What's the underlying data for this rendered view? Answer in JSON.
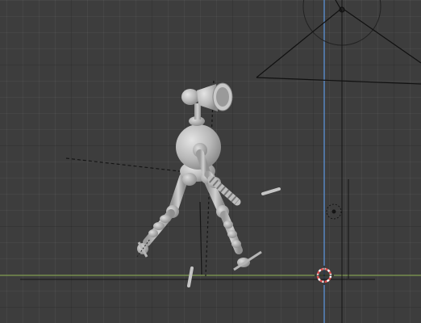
{
  "app": "3D viewport",
  "view": {
    "background": "#3d3d3d",
    "grid_major_color": "rgba(0,0,0,0.22)",
    "grid_minor_color": "rgba(255,255,255,0.045)",
    "x_axis_color": "#7e9a4f",
    "z_axis_color": "#5a8fd0",
    "model_color": "#b9b9b9",
    "cursor_color_primary": "#e05050",
    "cursor_color_secondary": "#ffffff"
  },
  "objects": [
    {
      "name": "robot-character",
      "type": "mesh"
    },
    {
      "name": "camera",
      "type": "camera"
    },
    {
      "name": "empty-target",
      "type": "empty"
    },
    {
      "name": "3d-cursor",
      "type": "cursor"
    }
  ]
}
